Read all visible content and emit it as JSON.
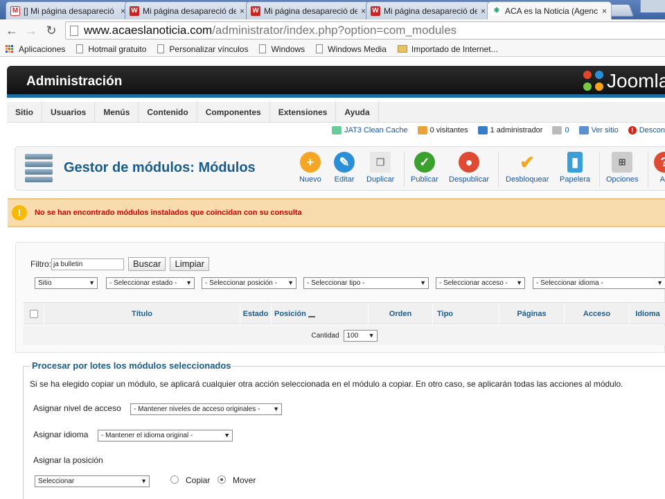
{
  "browser": {
    "tabs": [
      {
        "icon": "gmail-icon",
        "title": "[] Mi página desapareció",
        "active": false
      },
      {
        "icon": "w-icon",
        "title": "Mi página desapareció de",
        "active": false
      },
      {
        "icon": "w-icon",
        "title": "Mi página desapareció de",
        "active": false
      },
      {
        "icon": "w-icon",
        "title": "Mi página desapareció de",
        "active": false
      },
      {
        "icon": "joomla-icon",
        "title": "ACA es la Noticia (Agenc",
        "active": true
      }
    ],
    "close_glyph": "×",
    "url_host": "www.acaeslanoticia.com",
    "url_path": "/administrator/index.php?option=com_modules",
    "bookmarks": [
      "Aplicaciones",
      "Hotmail gratuito",
      "Personalizar vínculos",
      "Windows",
      "Windows Media",
      "Importado de Internet..."
    ]
  },
  "admin": {
    "title": "Administración",
    "logo_text": "Joomla"
  },
  "menu": [
    "Sitio",
    "Usuarios",
    "Menús",
    "Contenido",
    "Componentes",
    "Extensiones",
    "Ayuda"
  ],
  "status": {
    "cache": "JAT3 Clean Cache",
    "visitors": "0 visitantes",
    "admins": "1 administrador",
    "messages": "0",
    "view_site": "Ver sitio",
    "logout": "Descon"
  },
  "toolbar": {
    "page_title": "Gestor de módulos: Módulos",
    "buttons": [
      "Nuevo",
      "Editar",
      "Duplicar",
      "Publicar",
      "Despublicar",
      "Desbloquear",
      "Papelera",
      "Opciones",
      "Ay"
    ]
  },
  "alert": {
    "text": "No se han encontrado módulos instalados que coincidan con su consulta"
  },
  "filters": {
    "label": "Filtro:",
    "search_value": "ja bulletin",
    "search_button": "Buscar",
    "clear_button": "Limpiar",
    "selects": [
      "Sitio",
      "- Seleccionar estado -",
      "- Seleccionar posición -",
      "- Seleccionar tipo -",
      "- Seleccionar acceso -",
      "- Seleccionar idioma -"
    ]
  },
  "grid": {
    "columns": [
      "Título",
      "Estado",
      "Posición",
      "Orden",
      "Tipo",
      "Páginas",
      "Acceso",
      "Idioma"
    ],
    "quantity_label": "Cantidad",
    "quantity_value": "100"
  },
  "batch": {
    "legend": "Procesar por lotes los módulos seleccionados",
    "description": "Si se ha elegido copiar un módulo, se aplicará cualquier otra acción seleccionada en el módulo a copiar. En otro caso, se aplicarán todas las acciones al módulo.",
    "access_label": "Asignar nivel de acceso",
    "access_value": "- Mantener niveles de acceso originales -",
    "language_label": "Asignar idioma",
    "language_value": "- Mantener el idioma original -",
    "position_label": "Asignar la posición",
    "position_value": "Seleccionar",
    "copy_label": "Copiar",
    "move_label": "Mover",
    "selected_mode": "Mover"
  }
}
